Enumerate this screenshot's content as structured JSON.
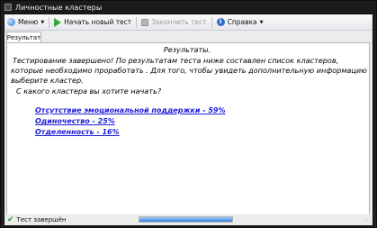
{
  "window": {
    "title": "Личностные кластеры"
  },
  "toolbar": {
    "menu_label": "Меню",
    "new_test_label": "Начать новый тест",
    "finish_test_label": "Закончить тест",
    "help_label": "Справка"
  },
  "tabs": [
    {
      "label": "Результат"
    }
  ],
  "content": {
    "heading": "Результаты.",
    "line1": "Тестирование завершено!  По результатам теста ниже составлен список кластеров,",
    "line2": "которые необходимо проработать . Для того, чтобы увидеть дополнительную информацию",
    "line3": "выберите кластер.",
    "question": "С какого кластера вы хотите начать?",
    "clusters": [
      {
        "label": "Отсутствие эмоциональной поддержки - 59%"
      },
      {
        "label": "Одиночество - 25%"
      },
      {
        "label": "Отделенность - 16%"
      }
    ]
  },
  "status": {
    "text": "Тест завершён",
    "progress": 1.0
  },
  "colors": {
    "link": "#1d1dd8",
    "status_check": "#2b9a2f",
    "progress": "#2f7fd8"
  },
  "icons": {
    "menu": "menu-icon",
    "new_test": "play-icon",
    "finish_test": "stop-icon",
    "help": "help-icon",
    "status": "check-icon"
  }
}
